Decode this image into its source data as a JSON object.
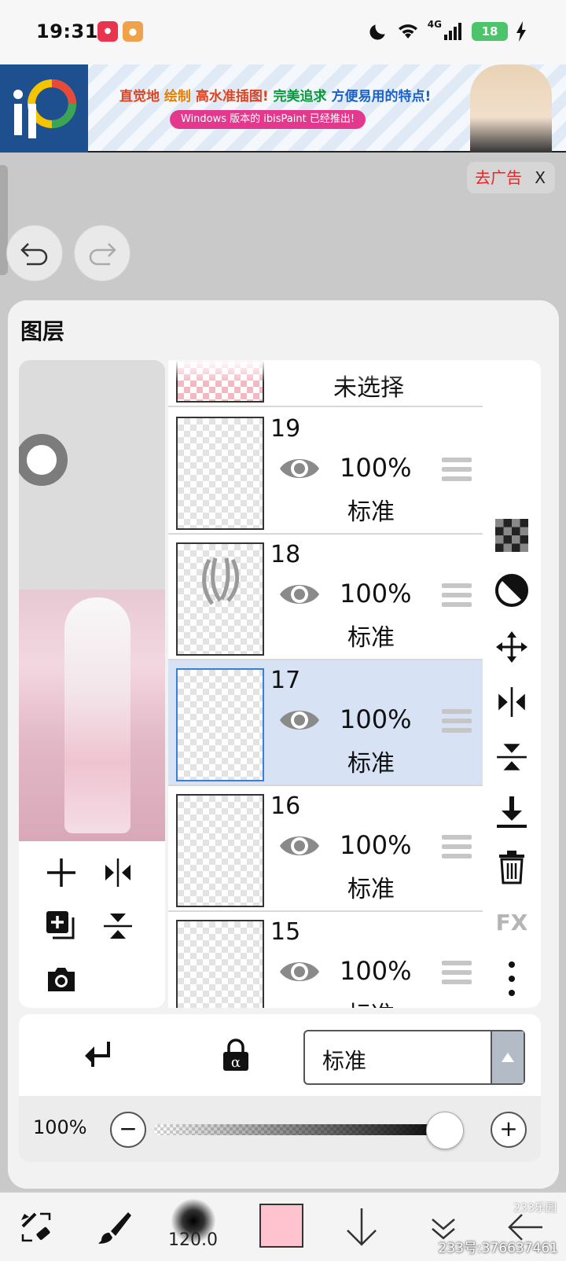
{
  "status_bar": {
    "time": "19:31",
    "network": "4G",
    "battery": "18"
  },
  "ad": {
    "headline_parts": [
      "直觉地",
      "绘制",
      "高水准插图!",
      "完美追求",
      "方便易用的特点!"
    ],
    "sub": "Windows 版本的 ibisPaint 已经推出!",
    "close_label": "去广告",
    "close_x": "X"
  },
  "layers_panel": {
    "title": "图层",
    "none_label": "未选择",
    "layers": [
      {
        "number": "19",
        "opacity": "100%",
        "mode": "标准",
        "selected": false
      },
      {
        "number": "18",
        "opacity": "100%",
        "mode": "标准",
        "selected": false
      },
      {
        "number": "17",
        "opacity": "100%",
        "mode": "标准",
        "selected": true
      },
      {
        "number": "16",
        "opacity": "100%",
        "mode": "标准",
        "selected": false
      },
      {
        "number": "15",
        "opacity": "100%",
        "mode": "标准",
        "selected": false
      }
    ],
    "right_tools": [
      "checker-icon",
      "contrast-icon",
      "move-icon",
      "flip-horizontal-icon",
      "flip-vertical-icon",
      "merge-down-icon",
      "trash-icon",
      "fx-button",
      "more-icon"
    ],
    "fx_label": "FX"
  },
  "controls": {
    "blend_mode": "标准",
    "opacity_label": "100%",
    "opacity_value": 1.0,
    "minus": "−",
    "plus": "+"
  },
  "toolbar": {
    "brush_size": "120.0",
    "color": "#ffc3cf",
    "watermark": "233号:376637461",
    "watermark_logo": "233乐园"
  },
  "colors": {
    "selected_row": "#d7e3f5",
    "selected_border": "#3a7fd5"
  }
}
